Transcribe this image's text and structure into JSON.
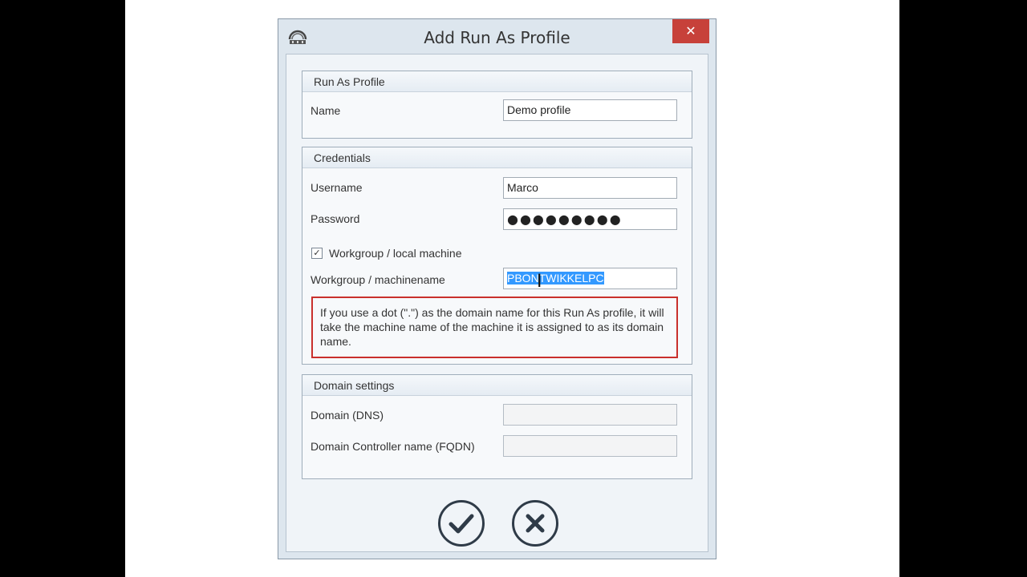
{
  "dialog": {
    "title": "Add Run As Profile",
    "close_label": "✕"
  },
  "run_as_profile": {
    "header": "Run As Profile",
    "name_label": "Name",
    "name_value": "Demo profile"
  },
  "credentials": {
    "header": "Credentials",
    "username_label": "Username",
    "username_value": "Marco",
    "password_label": "Password",
    "password_value": "●●●●●●●●●",
    "workgroup_checkbox_label": "Workgroup / local machine",
    "workgroup_checked": true,
    "machinename_label": "Workgroup / machinename",
    "machinename_value": "PBONTWIKKELPC",
    "info_text": "If you use a dot (\".\") as the domain name for this Run As profile, it will take the machine name of the machine it is assigned to as its domain name."
  },
  "domain_settings": {
    "header": "Domain settings",
    "domain_dns_label": "Domain (DNS)",
    "domain_dns_value": "",
    "dc_name_label": "Domain Controller name (FQDN)",
    "dc_name_value": ""
  },
  "colors": {
    "close_button": "#c7413a",
    "info_border": "#c9302c",
    "selection": "#3399ff"
  }
}
